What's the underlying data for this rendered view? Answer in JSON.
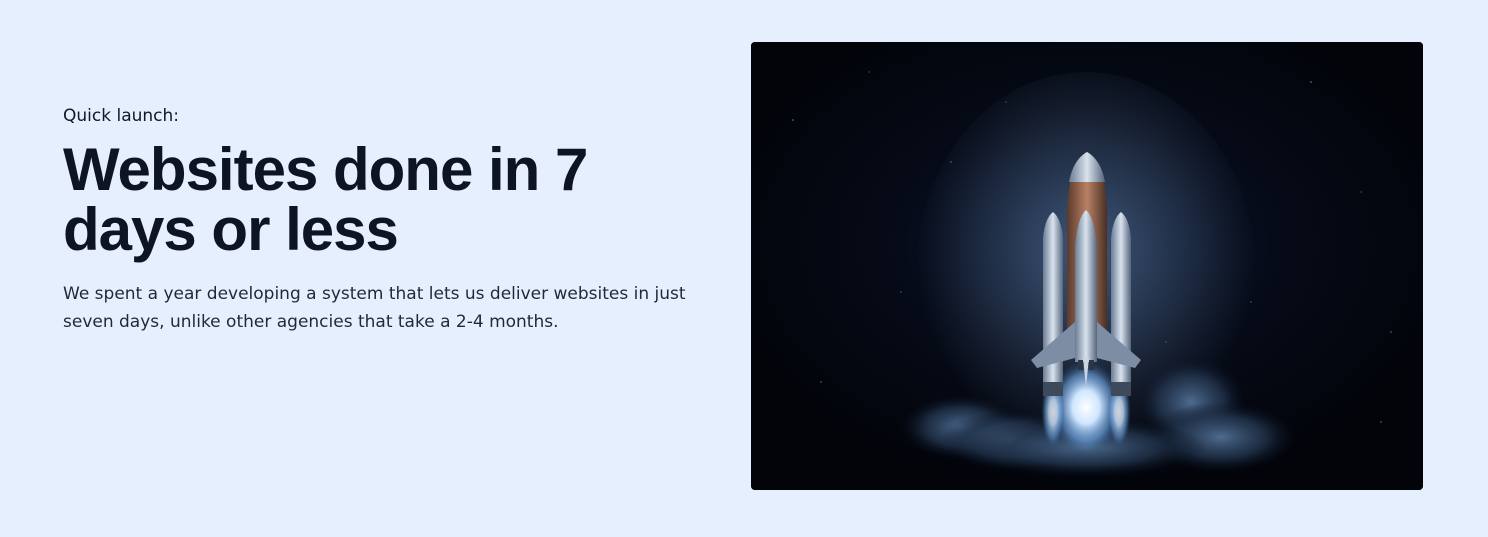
{
  "hero": {
    "eyebrow": "Quick launch:",
    "headline": "Websites done in 7 days or less",
    "body": "We spent a year developing a system that lets us deliver websites in just seven days, unlike other agencies that take a 2-4 months."
  },
  "media": {
    "subject": "rocket-launch-image",
    "background_color": "#03060d",
    "glow_color": "#9cc9ff"
  },
  "page": {
    "background_color": "#e5effe",
    "text_color": "#0d1424"
  }
}
